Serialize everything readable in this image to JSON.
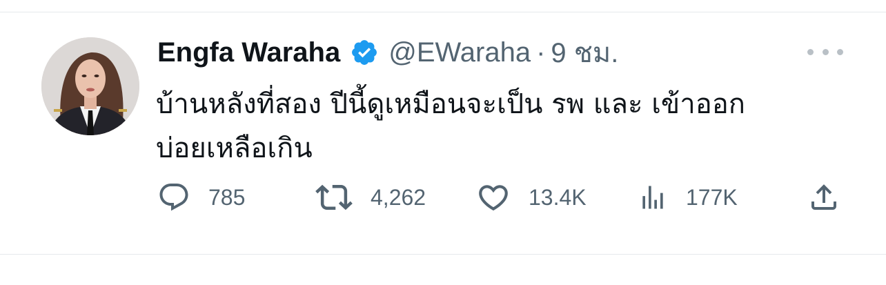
{
  "author": {
    "display_name": "Engfa Waraha",
    "handle": "@EWaraha",
    "verified": true
  },
  "meta": {
    "separator": "·",
    "time": "9 ชม."
  },
  "tweet": {
    "line1": "บ้านหลังที่สอง ปีนี้ดูเหมือนจะเป็น รพ และ เข้าออก",
    "line2": "บ่อยเหลือเกิน"
  },
  "actions": {
    "replies": "785",
    "retweets": "4,262",
    "likes": "13.4K",
    "views": "177K"
  },
  "icons": {
    "more": "more-horizontal-icon",
    "reply": "reply-bubble-icon",
    "retweet": "retweet-icon",
    "like": "heart-icon",
    "views": "analytics-bars-icon",
    "share": "share-upload-icon",
    "verified": "verified-badge-icon"
  },
  "colors": {
    "text_primary": "#0f1419",
    "text_secondary": "#536471",
    "verified_blue": "#1d9bf0",
    "divider": "#e6e9ec"
  }
}
